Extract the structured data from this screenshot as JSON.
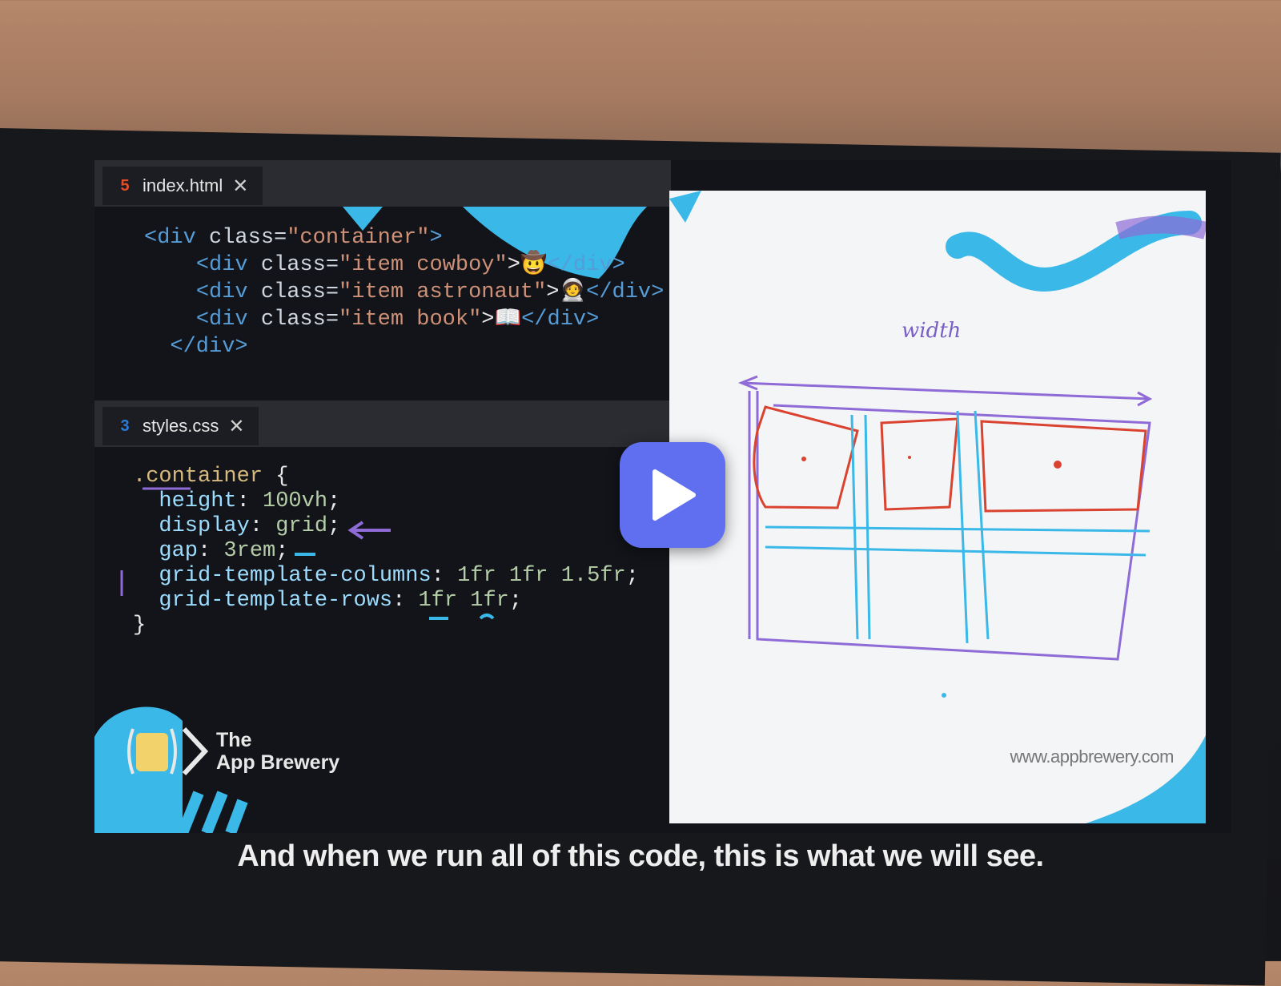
{
  "html_tab": {
    "icon": "html5-icon",
    "filename": "index.html",
    "close": "✕"
  },
  "css_tab": {
    "icon": "css3-icon",
    "filename": "styles.css",
    "close": "✕"
  },
  "html_code": {
    "l1_open": "<div",
    "l1_attr": " class=",
    "l1_str": "\"container\"",
    "l1_close": ">",
    "l2_open": "<div",
    "l2_attr": " class=",
    "l2_str": "\"item cowboy\"",
    "l2_rest": ">🤠",
    "l2_end": "</div>",
    "l3_open": "<div",
    "l3_attr": " class=",
    "l3_str": "\"item astronaut\"",
    "l3_rest": ">🧑‍🚀",
    "l3_end": "</div>",
    "l4_open": "<div",
    "l4_attr": " class=",
    "l4_str": "\"item book\"",
    "l4_rest": ">📖",
    "l4_end": "</div>",
    "l5": "</div>"
  },
  "css_code": {
    "selector": ".container",
    "brace_open": " {",
    "decls": [
      {
        "prop": "height",
        "val": "100vh"
      },
      {
        "prop": "display",
        "val": "grid"
      },
      {
        "prop": "gap",
        "val": "3rem"
      },
      {
        "prop": "grid-template-columns",
        "val": "1fr 1fr 1.5fr"
      },
      {
        "prop": "grid-template-rows",
        "val": "1fr 1fr"
      }
    ],
    "brace_close": "}"
  },
  "whiteboard": {
    "annotation": "width",
    "url": "www.appbrewery.com"
  },
  "brand": {
    "line1": "The",
    "line2": "App Brewery"
  },
  "play": {
    "icon": "play-icon"
  },
  "caption": "And when we run all of this code, this is what we will see.",
  "colors": {
    "accent_blue": "#3ab8e8",
    "play": "#5f6ff0",
    "grid_red": "#d9432f",
    "grid_purple": "#8e6bd6"
  }
}
